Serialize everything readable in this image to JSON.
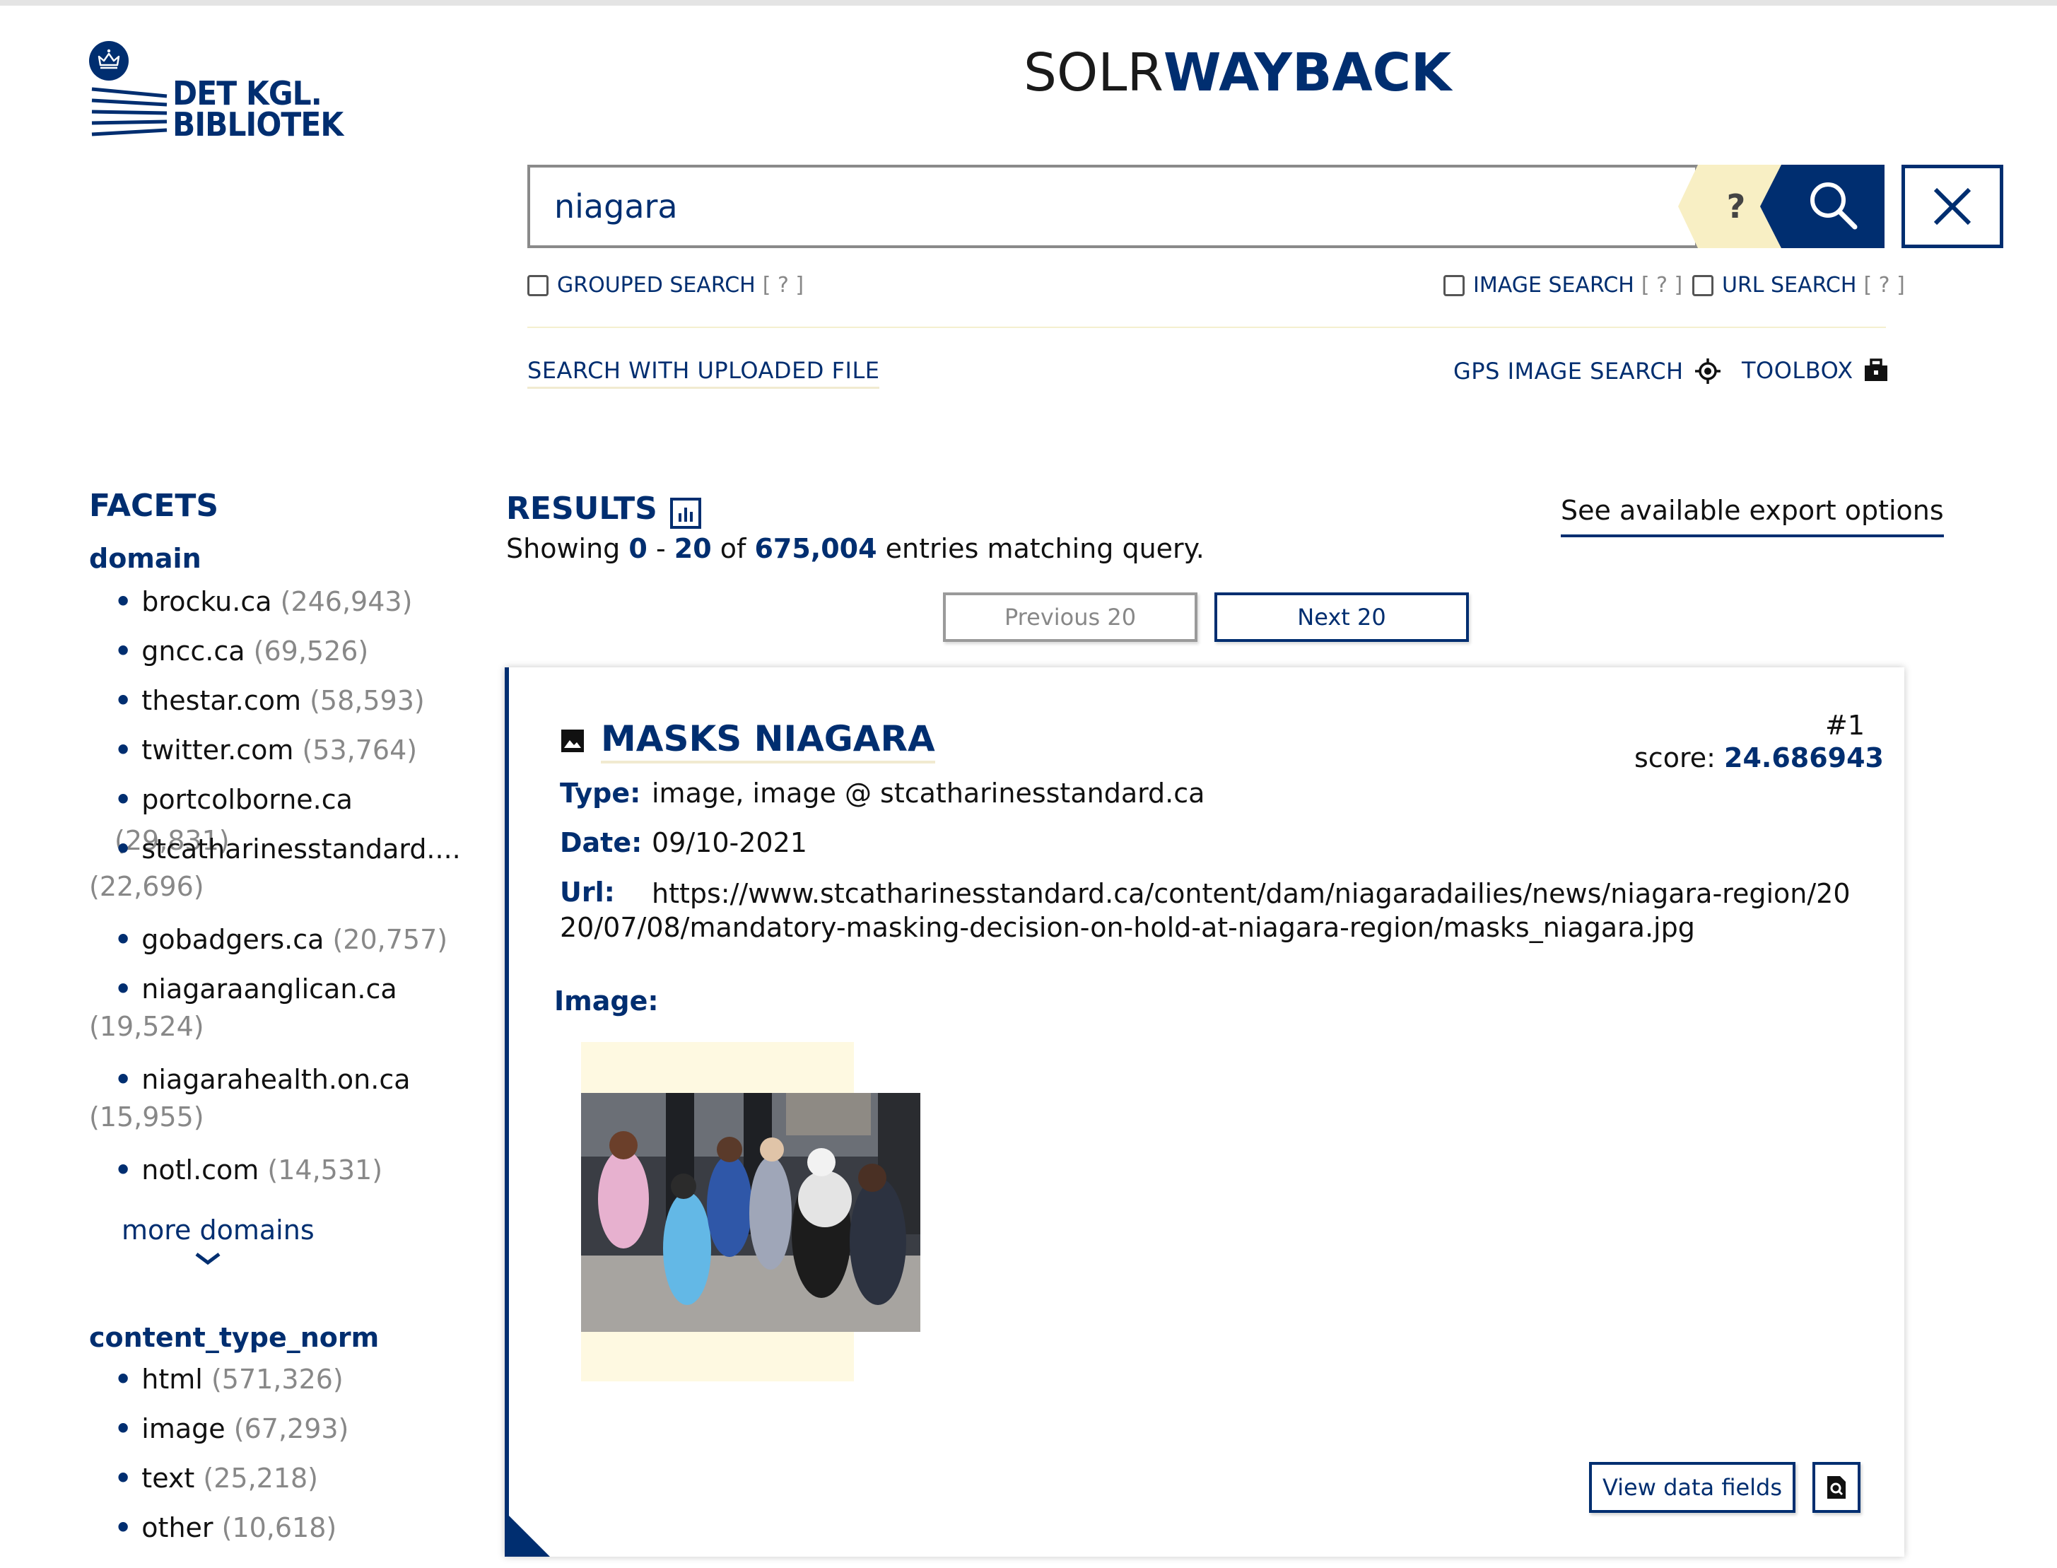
{
  "logo": {
    "line1": "DET KGL.",
    "line2": "BIBLIOTEK"
  },
  "app_title": {
    "part1": "SOLR",
    "part2": "WAYBACK"
  },
  "search": {
    "value": "niagara",
    "help": "?"
  },
  "options": {
    "grouped": "GROUPED SEARCH",
    "image": "IMAGE SEARCH",
    "url": "URL SEARCH",
    "hint": "[ ? ]"
  },
  "tools": {
    "upload": "SEARCH WITH UPLOADED FILE",
    "gps": "GPS IMAGE SEARCH",
    "toolbox": "TOOLBOX"
  },
  "facets": {
    "heading": "FACETS",
    "domain_label": "domain",
    "domain_items": [
      {
        "name": "brocku.ca",
        "count": "(246,943)"
      },
      {
        "name": "gncc.ca",
        "count": "(69,526)"
      },
      {
        "name": "thestar.com",
        "count": "(58,593)"
      },
      {
        "name": "twitter.com",
        "count": "(53,764)"
      },
      {
        "name": "portcolborne.ca",
        "count": "(29,831)"
      },
      {
        "name": "stcatharinesstandard....",
        "count": "(22,696)"
      },
      {
        "name": "gobadgers.ca",
        "count": "(20,757)"
      },
      {
        "name": "niagaraanglican.ca",
        "count": "(19,524)"
      },
      {
        "name": "niagarahealth.on.ca",
        "count": "(15,955)"
      },
      {
        "name": "notl.com",
        "count": "(14,531)"
      }
    ],
    "more_domains": "more domains",
    "content_type_label": "content_type_norm",
    "content_type_items": [
      {
        "name": "html",
        "count": "(571,326)"
      },
      {
        "name": "image",
        "count": "(67,293)"
      },
      {
        "name": "text",
        "count": "(25,218)"
      },
      {
        "name": "other",
        "count": "(10,618)"
      }
    ]
  },
  "results": {
    "heading": "RESULTS",
    "showing_prefix": "Showing",
    "from": "0",
    "dash": "-",
    "to": "20",
    "of": "of",
    "total": "675,004",
    "suffix": "entries matching query.",
    "export": "See available export options",
    "prev": "Previous 20",
    "next": "Next 20"
  },
  "result1": {
    "title": "MASKS NIAGARA",
    "rank": "#1",
    "score_label": "score:",
    "score": "24.686943",
    "type_label": "Type:",
    "type": "image, image @ stcatharinesstandard.ca",
    "date_label": "Date:",
    "date": "09/10-2021",
    "url_label": "Url:",
    "url": "https://www.stcatharinesstandard.ca/content/dam/niagaradailies/news/niagara-region/2020/07/08/mandatory-masking-decision-on-hold-at-niagara-region/masks_niagara.jpg",
    "image_label": "Image:",
    "view_fields": "View data fields"
  },
  "colors": {
    "brand": "#002e70",
    "accent_bg": "#fef9e1",
    "help_bg": "#f8efc4"
  },
  "icons": [
    "crown-icon",
    "search-icon",
    "close-icon",
    "help-icon",
    "gps-icon",
    "toolbox-icon",
    "chart-icon",
    "image-icon",
    "chevron-down-icon",
    "document-search-icon"
  ]
}
